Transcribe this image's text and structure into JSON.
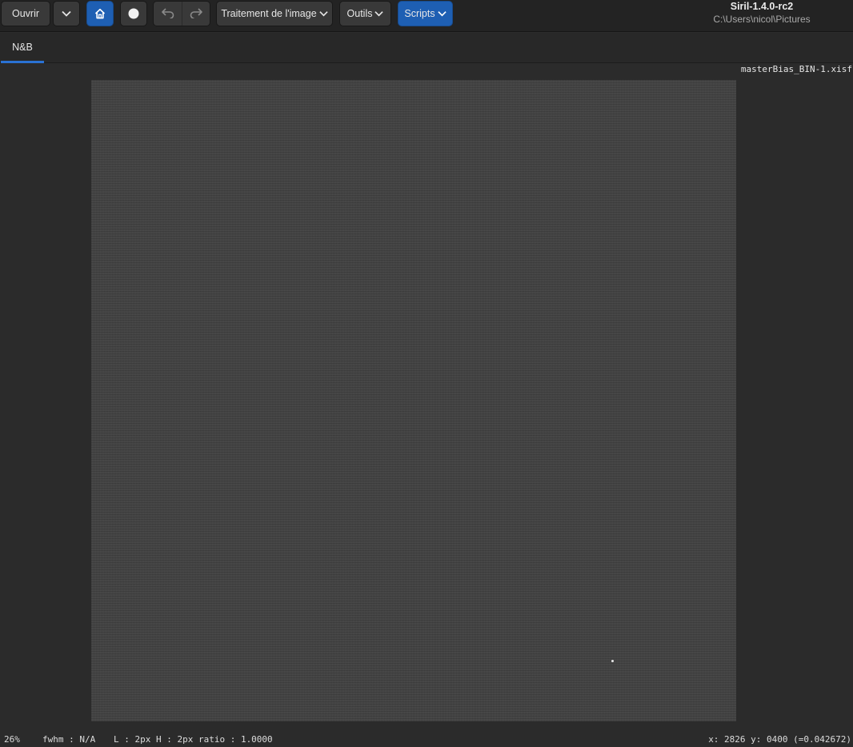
{
  "header": {
    "open_label": "Ouvrir",
    "image_processing_label": "Traitement de l'image",
    "tools_label": "Outils",
    "scripts_label": "Scripts",
    "app_title": "Siril-1.4.0-rc2",
    "working_dir": "C:\\Users\\nicol\\Pictures",
    "icons": {
      "open_menu": "chevron-down-icon",
      "home": "home-icon",
      "livestack": "record-dot-icon",
      "undo": "undo-icon",
      "redo": "redo-icon"
    },
    "accent_color": "#1e5fb3"
  },
  "tabs": [
    {
      "label": "N&B",
      "active": true
    }
  ],
  "viewer": {
    "filename": "masterBias_BIN-1.xisf"
  },
  "status": {
    "zoom": "26%",
    "fwhm": "fwhm : N/A",
    "binning": "L : 2px H : 2px ratio : 1.0000",
    "cursor": "x: 2826 y: 0400 (=0.042672)"
  }
}
